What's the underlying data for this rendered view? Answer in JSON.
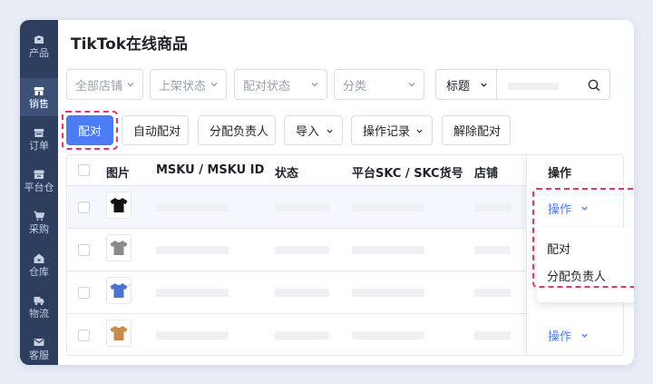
{
  "sidebar": {
    "items": [
      {
        "label": "产品",
        "icon": "box-icon"
      },
      {
        "label": "销售",
        "icon": "store-icon"
      },
      {
        "label": "订单",
        "icon": "order-icon"
      },
      {
        "label": "平台仓",
        "icon": "warehouse-icon"
      },
      {
        "label": "采购",
        "icon": "cart-icon"
      },
      {
        "label": "仓库",
        "icon": "house-icon"
      },
      {
        "label": "物流",
        "icon": "truck-icon"
      },
      {
        "label": "客服",
        "icon": "mail-icon"
      }
    ],
    "active_index": 1
  },
  "page_title": "TikTok在线商品",
  "filters": {
    "store": "全部店铺",
    "listing_status": "上架状态",
    "pair_status": "配对状态",
    "category": "分类",
    "search_field": "标题"
  },
  "toolbar": {
    "pair": "配对",
    "auto_pair": "自动配对",
    "assign_owner": "分配负责人",
    "import": "导入",
    "operation_log": "操作记录",
    "unpair": "解除配对"
  },
  "table": {
    "columns": {
      "image": "图片",
      "msku": "MSKU / MSKU ID",
      "status": "状态",
      "skc": "平台SKC / SKC货号",
      "store": "店铺",
      "actions": "操作"
    },
    "rows": [
      {
        "shirt_color": "#111111",
        "action": "操作"
      },
      {
        "shirt_color": "#8a8a8a",
        "action": "操作"
      },
      {
        "shirt_color": "#4a72d0",
        "action": "操作"
      },
      {
        "shirt_color": "#c98a45",
        "action": "操作"
      }
    ]
  },
  "action_menu": {
    "items": [
      "配对",
      "分配负责人"
    ]
  },
  "colors": {
    "primary": "#4b7cf3",
    "sidebar": "#2d3e5e",
    "highlight_dashed": "#e4336f"
  }
}
